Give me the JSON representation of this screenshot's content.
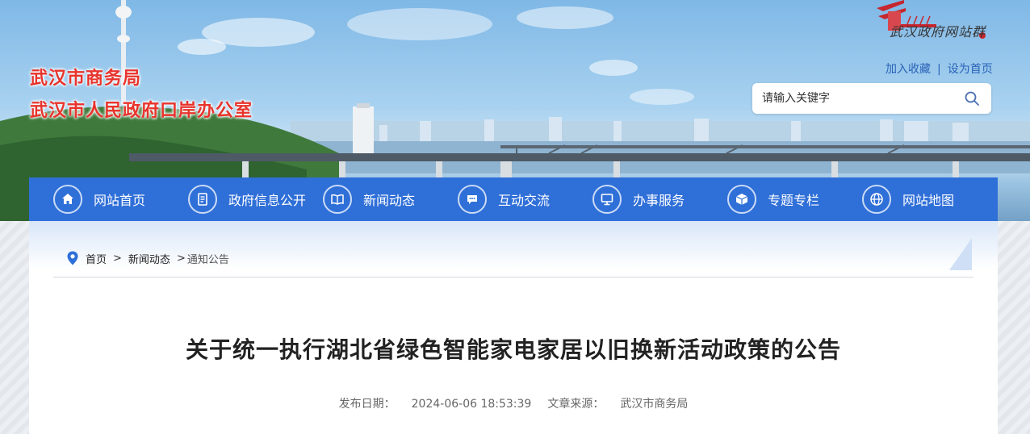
{
  "header": {
    "title_line1": "武汉市商务局",
    "title_line2": "武汉市人民政府口岸办公室",
    "group_logo_text": "武汉政府网站群",
    "links": {
      "favorite": "加入收藏",
      "separator": "|",
      "homepage": "设为首页"
    },
    "search": {
      "placeholder": "请输入关键字",
      "value": ""
    }
  },
  "nav": {
    "items": [
      {
        "label": "网站首页",
        "icon": "home-icon"
      },
      {
        "label": "政府信息公开",
        "icon": "document-icon"
      },
      {
        "label": "新闻动态",
        "icon": "book-icon"
      },
      {
        "label": "互动交流",
        "icon": "chat-icon"
      },
      {
        "label": "办事服务",
        "icon": "monitor-icon"
      },
      {
        "label": "专题专栏",
        "icon": "cube-icon"
      },
      {
        "label": "网站地图",
        "icon": "globe-icon"
      }
    ]
  },
  "breadcrumb": {
    "home": "首页",
    "sep1": ">",
    "section": "新闻动态",
    "sep2": ">",
    "current": "通知公告"
  },
  "article": {
    "title": "关于统一执行湖北省绿色智能家电家居以旧换新活动政策的公告",
    "publish_label": "发布日期：",
    "publish_date": "2024-06-06 18:53:39",
    "source_label": "文章来源：",
    "source": "武汉市商务局"
  },
  "colors": {
    "nav_bg": "#2f6fd8",
    "title_red": "#e8332c",
    "link_blue": "#2a62b7"
  }
}
